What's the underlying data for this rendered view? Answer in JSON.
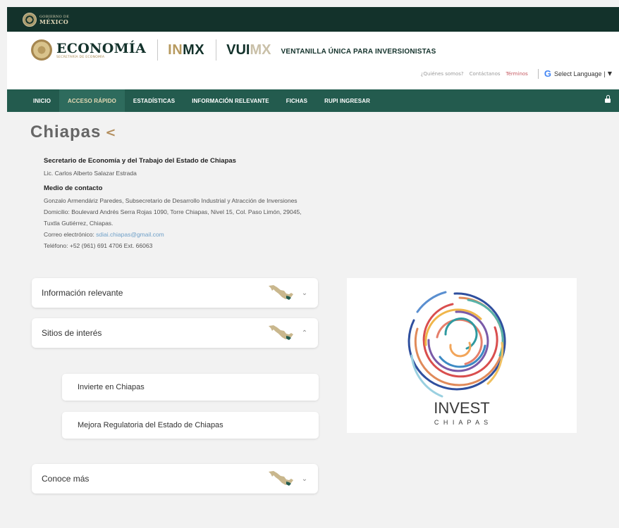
{
  "gov": {
    "line1": "GOBIERNO DE",
    "line2": "MÉXICO"
  },
  "header": {
    "brand": "ECONOMÍA",
    "brand_sub": "SECRETARÍA DE ECONOMÍA",
    "inmx_a": "IN",
    "inmx_b": "MX",
    "vui_a": "VUI",
    "vui_b": "MX",
    "ventanilla": "VENTANILLA ÚNICA PARA INVERSIONISTAS",
    "links": [
      "¿Quiénes somos?",
      "Contáctanos",
      "Términos"
    ],
    "google_icon": "G",
    "language": "Select Language",
    "language_sep": "|",
    "language_arrow": "▼"
  },
  "nav": {
    "items": [
      "INICIO",
      "ACCESO RÁPIDO",
      "ESTADÍSTICAS",
      "INFORMACIÓN RELEVANTE",
      "FICHAS",
      "RUPI INGRESAR"
    ],
    "active_index": 1
  },
  "page": {
    "title": "Chiapas",
    "share_icon": "<"
  },
  "contact": {
    "heading1": "Secretario de Economía y del Trabajo del Estado de Chiapas",
    "name": "Lic. Carlos Alberto Salazar Estrada",
    "heading2": "Medio de contacto",
    "line1": "Gonzalo Armendáriz Paredes, Subsecretario de Desarrollo Industrial y Atracción de Inversiones",
    "line2": "Domicilio: Boulevard Andrés Serra Rojas 1090, Torre Chiapas, Nivel 15, Col. Paso Limón, 29045,",
    "line3": "Tuxtla Gutiérrez, Chiapas.",
    "email_label": "Correo electrónico: ",
    "email": "sdiai.chiapas@gmail.com",
    "phone": "Teléfono: +52 (961) 691 4706 Ext. 66063"
  },
  "accordions": [
    {
      "label": "Información relevante",
      "chevron": "⌄"
    },
    {
      "label": "Sitios de interés",
      "chevron": "⌃"
    },
    {
      "label": "Conoce más",
      "chevron": "⌄"
    }
  ],
  "sites": [
    "Invierte en Chiapas",
    "Mejora Regulatoria del Estado de Chiapas"
  ],
  "invest": {
    "title": "INVEST",
    "subtitle": "C H I A P A S"
  },
  "colors": {
    "gov_bar": "#13322b",
    "nav": "#235b4e",
    "accent_gold": "#b38e5d",
    "link_red": "#c65a62"
  }
}
